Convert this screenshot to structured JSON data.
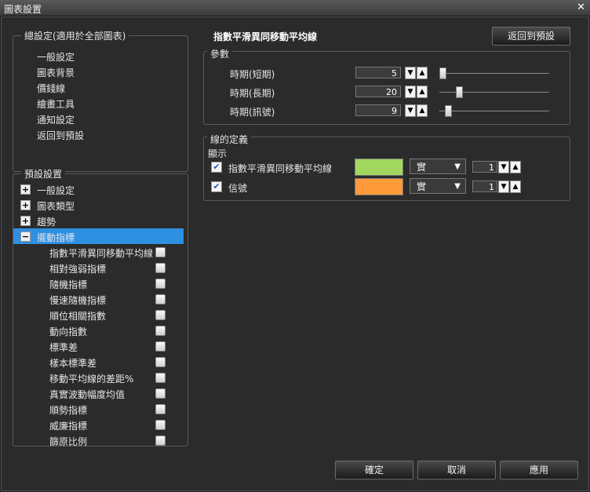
{
  "window": {
    "title": "圖表設置",
    "close_glyph": "✕"
  },
  "general_settings": {
    "title": "總設定(適用於全部圖表)",
    "items": [
      "一般設定",
      "圖表背景",
      "價錢線",
      "繪畫工具",
      "通知設定",
      "返回到預設"
    ]
  },
  "preset_settings": {
    "title": "預設設置",
    "tree": [
      {
        "label": "一般設定",
        "expander": "+",
        "selected": false
      },
      {
        "label": "圖表類型",
        "expander": "+",
        "selected": false
      },
      {
        "label": "趨勢",
        "expander": "+",
        "selected": false
      },
      {
        "label": "擺動指標",
        "expander": "−",
        "selected": true
      }
    ],
    "oscillators": [
      "指數平滑異同移動平均線",
      "相對強弱指標",
      "隨機指標",
      "慢速隨機指標",
      "順位相關指數",
      "動向指數",
      "標準差",
      "樣本標準差",
      "移動平均線的差距%",
      "真實波動幅度均值",
      "順勢指標",
      "威廉指標",
      "篩原比例"
    ]
  },
  "indicator": {
    "title": "指數平滑異同移動平均線",
    "reset_label": "返回到預設",
    "params_title": "參數",
    "params": [
      {
        "label": "時期(短期)",
        "value": "5",
        "slider_level": 0.0
      },
      {
        "label": "時期(長期)",
        "value": "20",
        "slider_level": 0.15
      },
      {
        "label": "時期(訊號)",
        "value": "9",
        "slider_level": 0.05
      }
    ],
    "lines_title": "線的定義",
    "display_label": "顯示",
    "lines": [
      {
        "label": "指數平滑異同移動平均線",
        "checked": true,
        "color": "#a3d860",
        "style": "實",
        "width": "1"
      },
      {
        "label": "信號",
        "checked": true,
        "color": "#ff9a3a",
        "style": "實",
        "width": "1"
      }
    ]
  },
  "footer": {
    "ok_label": "確定",
    "cancel_label": "取消",
    "apply_label": "應用"
  },
  "glyphs": {
    "down": "▼",
    "up": "▲",
    "check": "✔",
    "dropdown": "▼"
  }
}
